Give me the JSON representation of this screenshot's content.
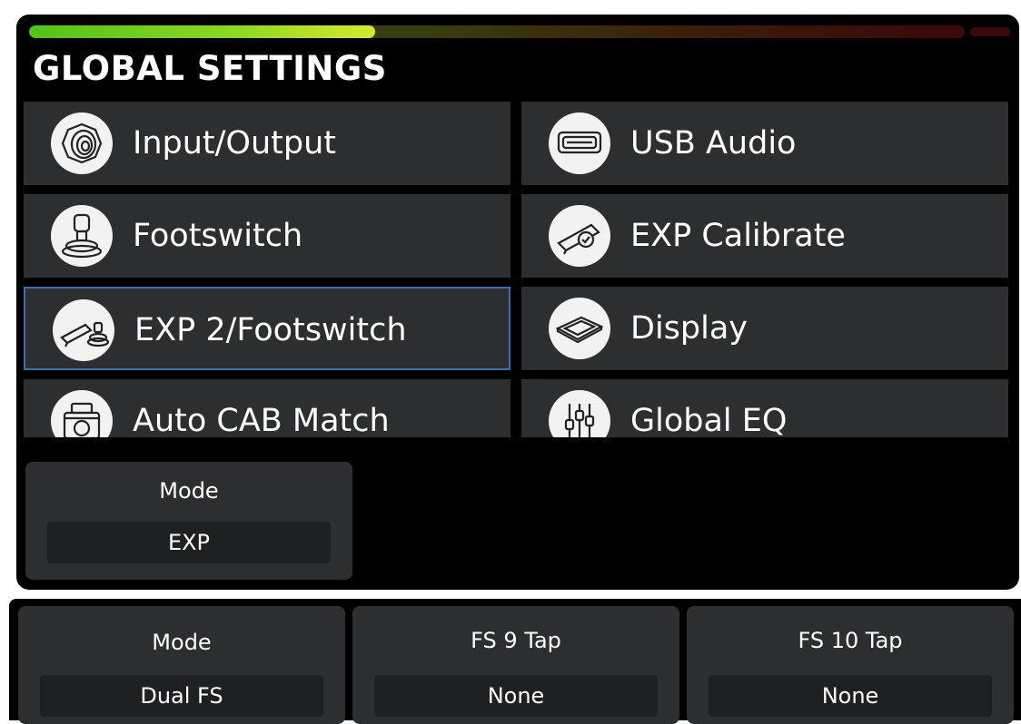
{
  "meter": {
    "level": 0.37
  },
  "title": "GLOBAL SETTINGS",
  "menu": [
    {
      "label": "Input/Output",
      "icon": "jack-icon"
    },
    {
      "label": "USB Audio",
      "icon": "usb-port-icon"
    },
    {
      "label": "Footswitch",
      "icon": "footswitch-icon"
    },
    {
      "label": "EXP Calibrate",
      "icon": "expression-pedal-check-icon"
    },
    {
      "label": "EXP 2/Footswitch",
      "icon": "pedal-footswitch-icon",
      "selected": true
    },
    {
      "label": "Display",
      "icon": "display-icon"
    },
    {
      "label": "Auto CAB Match",
      "icon": "cabinet-icon"
    },
    {
      "label": "Global EQ",
      "icon": "eq-sliders-icon"
    }
  ],
  "exp_panel": {
    "label": "Mode",
    "value": "EXP"
  },
  "footswitch_params": [
    {
      "label": "Mode",
      "value": "Dual FS"
    },
    {
      "label": "FS 9 Tap",
      "value": "None"
    },
    {
      "label": "FS 10 Tap",
      "value": "None"
    }
  ],
  "colors": {
    "selected_border": "#3a6fb5",
    "card_bg": "#2c2e30",
    "meter_green": "#4fc418"
  }
}
